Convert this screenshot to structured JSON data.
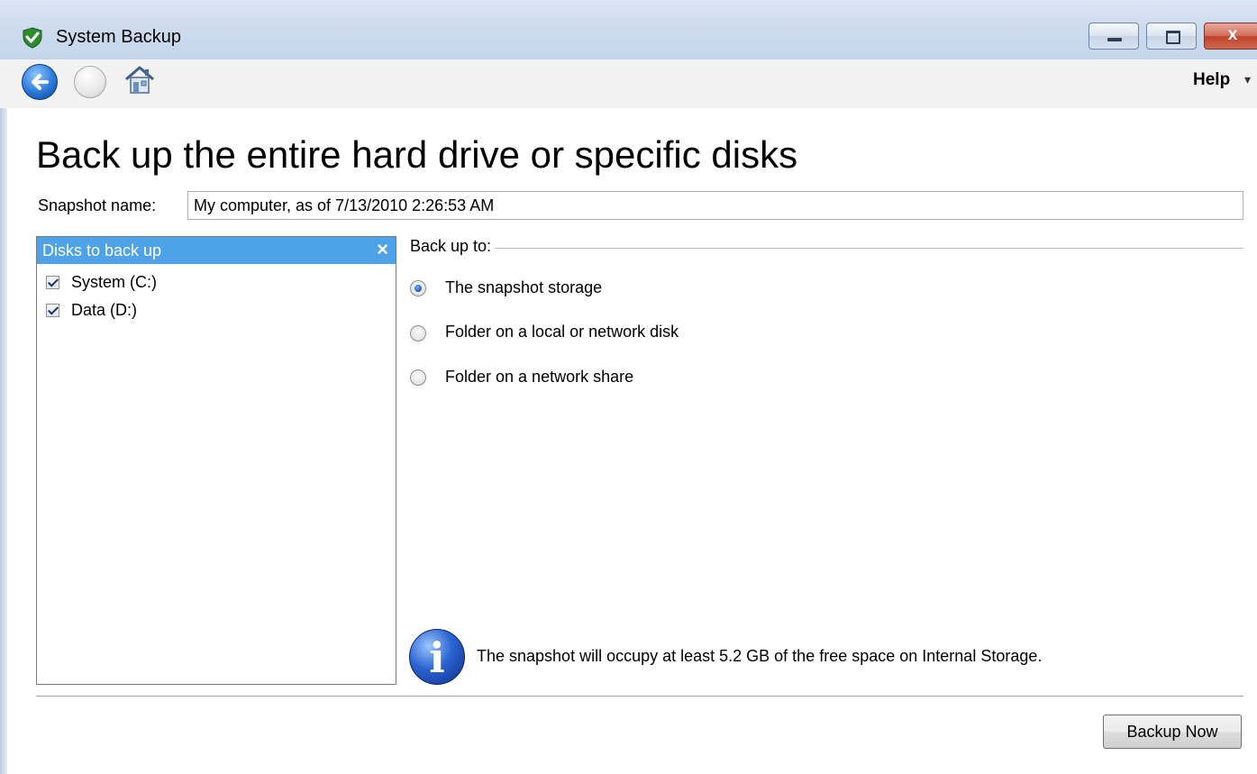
{
  "window": {
    "title": "System Backup",
    "close_glyph": "x",
    "controls": [
      "minimize",
      "maximize",
      "close"
    ]
  },
  "toolbar": {
    "icons": [
      "back-arrow-icon",
      "forward-arrow-icon",
      "home-icon"
    ],
    "help_label": "Help",
    "help_arrow": "▾"
  },
  "page": {
    "title": "Back up the entire hard drive or specific disks",
    "snapshot_label": "Snapshot name:",
    "snapshot_value": "My computer, as of 7/13/2010 2:26:53 AM"
  },
  "disks_panel": {
    "header": "Disks to back up",
    "close_glyph": "×",
    "items": [
      {
        "label": "System (C:)",
        "checked": true
      },
      {
        "label": "Data (D:)",
        "checked": true
      }
    ]
  },
  "backup_to": {
    "label": "Back up to:",
    "options": [
      {
        "label": "The snapshot storage",
        "selected": true
      },
      {
        "label": "Folder on a local or network disk",
        "selected": false
      },
      {
        "label": "Folder on a network share",
        "selected": false
      }
    ]
  },
  "info": {
    "icon_glyph": "i",
    "text": "The snapshot will occupy at least 5.2 GB of the free space on Internal Storage."
  },
  "actions": {
    "backup_now": "Backup Now"
  },
  "colors": {
    "titlebar": "#cfdcee",
    "panel_header": "#4ea2e8",
    "close_button": "#c0412a"
  }
}
